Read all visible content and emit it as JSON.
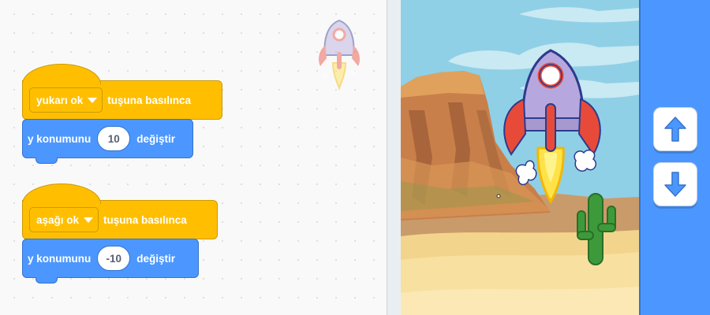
{
  "scripts": [
    {
      "hat": {
        "key_label": "yukarı ok",
        "event_text": "tuşuna basılınca"
      },
      "motion": {
        "prefix": "y konumunu",
        "value": "10",
        "suffix": "değiştir"
      }
    },
    {
      "hat": {
        "key_label": "aşağı ok",
        "event_text": "tuşuna basılınca"
      },
      "motion": {
        "prefix": "y konumunu",
        "value": "-10",
        "suffix": "değiştir"
      }
    }
  ],
  "stage": {
    "backdrop": "desert",
    "sprite": "rocketship",
    "cactus": "cactus"
  },
  "controls": {
    "up_icon": "arrow-up-icon",
    "down_icon": "arrow-down-icon"
  },
  "colors": {
    "events": "#ffbf00",
    "motion": "#4c97ff",
    "panel": "#4c97ff"
  }
}
